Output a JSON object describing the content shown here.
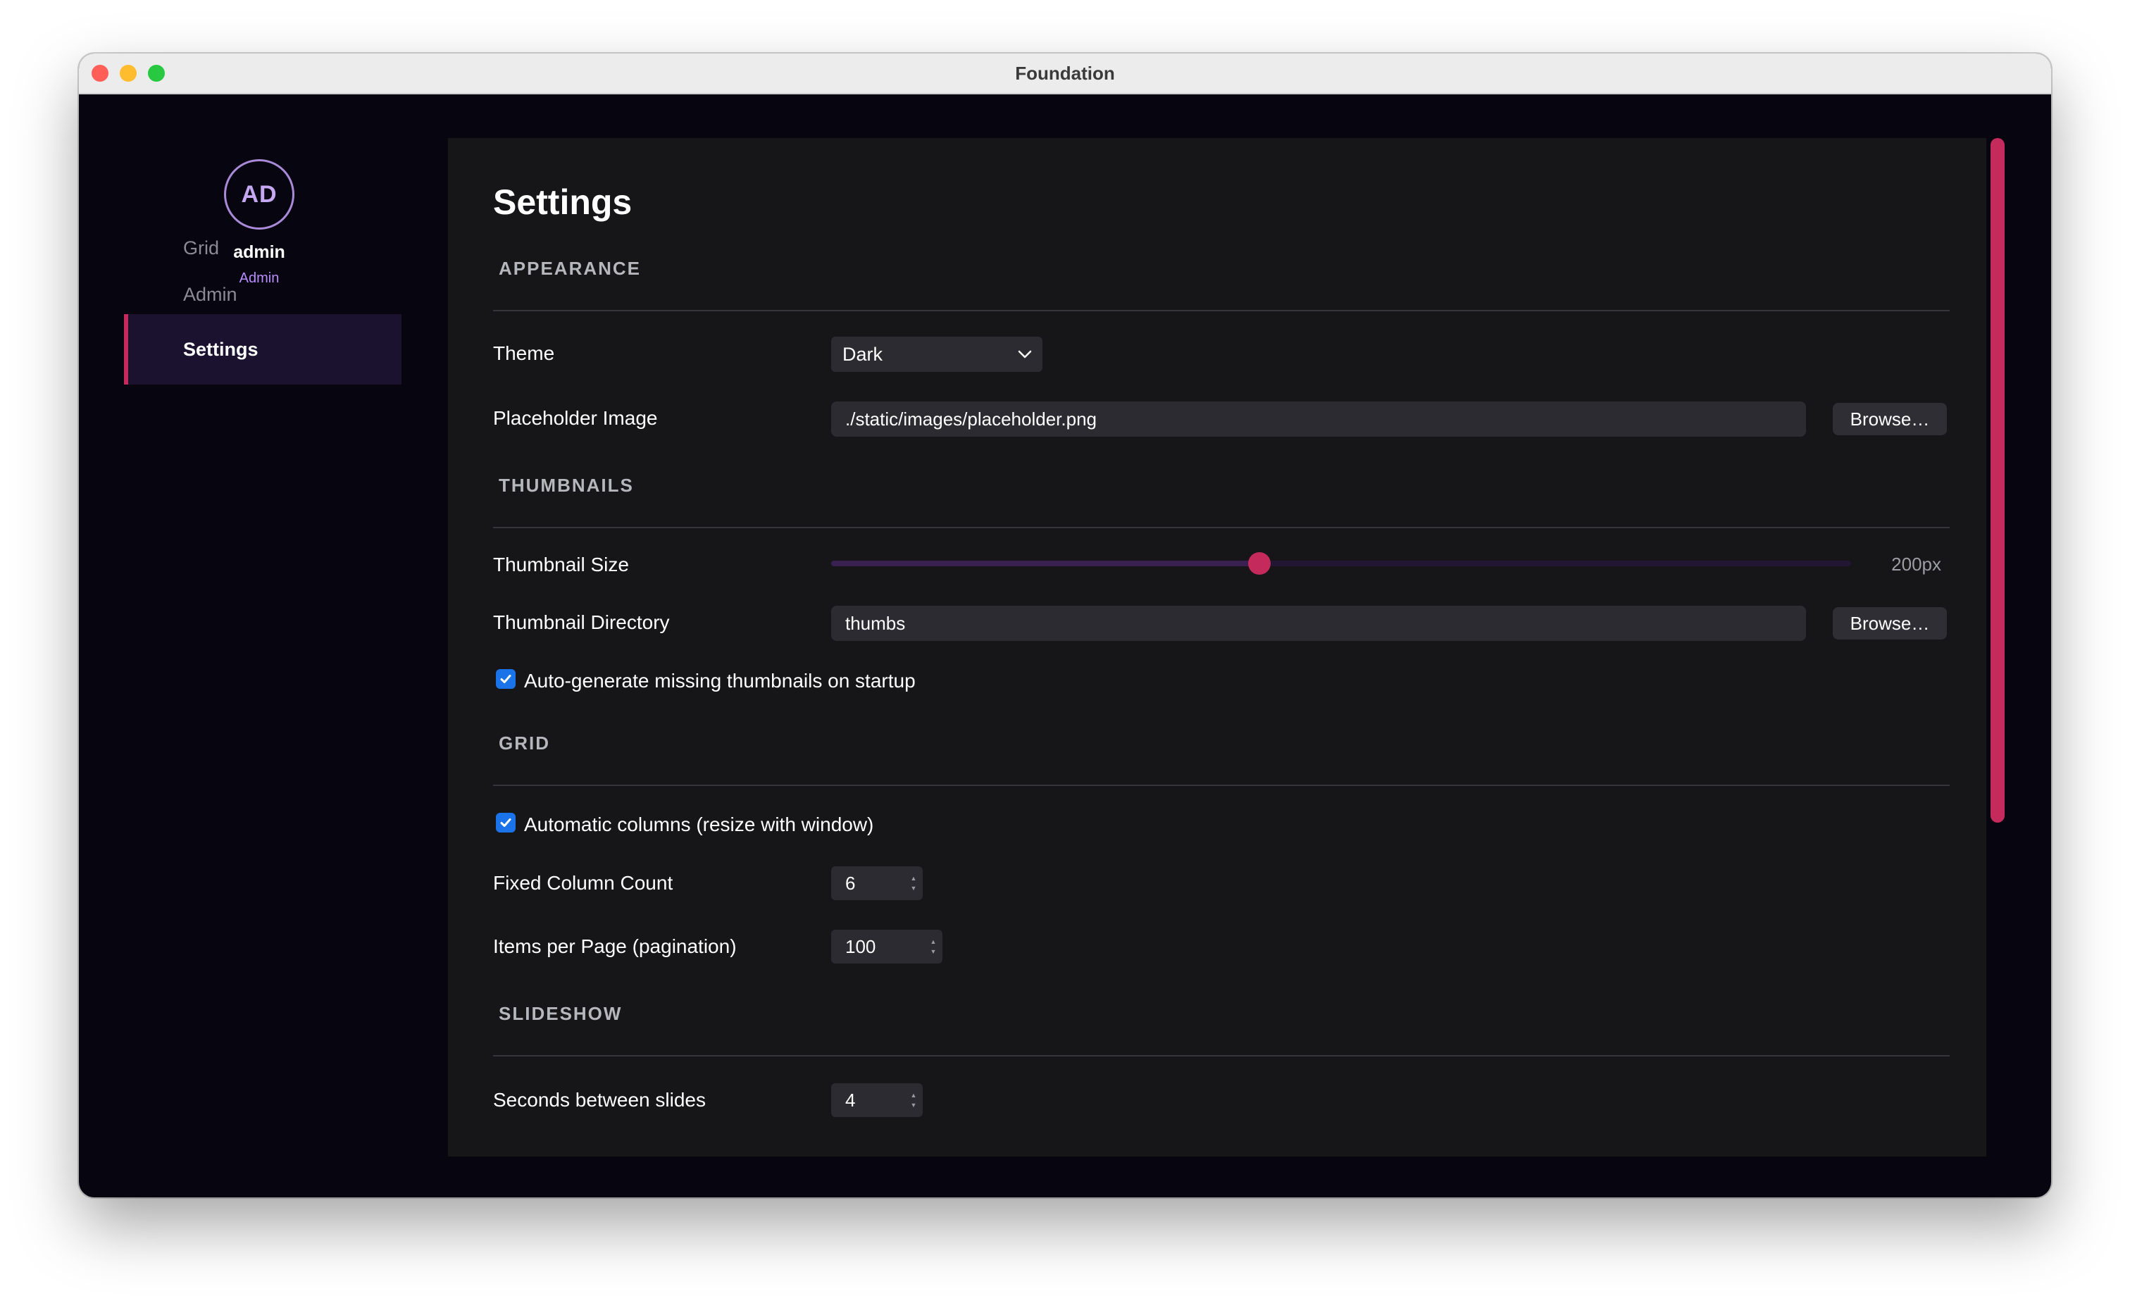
{
  "window": {
    "title": "Foundation"
  },
  "sidebar": {
    "avatar_initials": "AD",
    "user_name": "admin",
    "user_role": "Admin",
    "nav": [
      {
        "label": "Grid",
        "active": false
      },
      {
        "label": "Admin",
        "active": false
      },
      {
        "label": "Settings",
        "active": true
      }
    ]
  },
  "settings": {
    "title": "Settings",
    "appearance": {
      "heading": "APPEARANCE",
      "theme_label": "Theme",
      "theme_value": "Dark",
      "placeholder_label": "Placeholder Image",
      "placeholder_value": "./static/images/placeholder.png",
      "browse_label": "Browse…"
    },
    "thumbnails": {
      "heading": "THUMBNAILS",
      "size_label": "Thumbnail Size",
      "size_value": "200px",
      "size_fraction": 0.42,
      "directory_label": "Thumbnail Directory",
      "directory_value": "thumbs",
      "browse_label": "Browse…",
      "autogen_label": "Auto-generate missing thumbnails on startup",
      "autogen_checked": true
    },
    "grid": {
      "heading": "GRID",
      "auto_columns_label": "Automatic columns (resize with window)",
      "auto_columns_checked": true,
      "column_count_label": "Fixed Column Count",
      "column_count_value": "6",
      "items_per_page_label": "Items per Page (pagination)",
      "items_per_page_value": "100"
    },
    "slideshow": {
      "heading": "SLIDESHOW",
      "seconds_label": "Seconds between slides",
      "seconds_value": "4"
    }
  },
  "colors": {
    "accent": "#c42a5c",
    "sidebar_bg": "#07050f",
    "panel_bg": "#161619",
    "checkbox": "#1a73e8"
  }
}
